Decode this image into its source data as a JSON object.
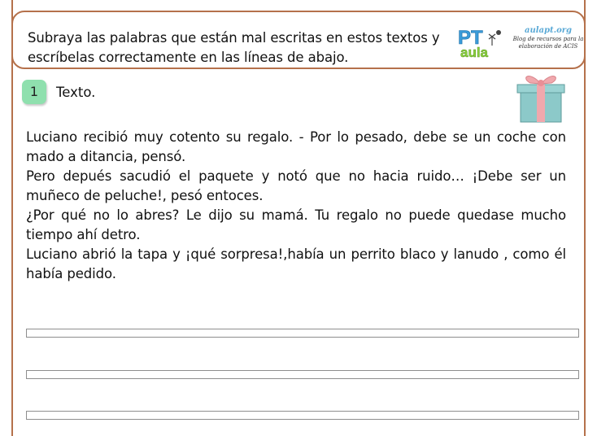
{
  "header": {
    "instruction": "Subraya las palabras que están mal escritas  en estos textos y escríbelas correctamente en las líneas de abajo.",
    "logo": {
      "pt_letters": "PT",
      "aula_word": "aula",
      "site": "aulapt.org",
      "tagline": "Blog de recursos para la elaboración de ACIS"
    }
  },
  "section": {
    "number": "1",
    "title": "Texto."
  },
  "text": {
    "paragraphs": [
      "Luciano recibió muy cotento su regalo. - Por lo pesado, debe se un coche con mado a ditancia, pensó.",
      "Pero depués sacudió el paquete y notó que no hacia ruido… ¡Debe ser un muñeco de peluche!, pesó entoces.",
      "¿Por qué no lo abres? Le dijo su mamá. Tu regalo no puede quedase mucho tiempo ahí detro.",
      "Luciano abrió la tapa y ¡qué sorpresa!,había un perrito blaco y lanudo , como él había pedido."
    ]
  },
  "colors": {
    "frame": "#b5714b",
    "badge": "#8fe0ae",
    "gift_box": "#8cc9c9",
    "gift_ribbon": "#f0a8ad"
  },
  "icons": [
    "pt-aula-logo",
    "gift-icon"
  ]
}
